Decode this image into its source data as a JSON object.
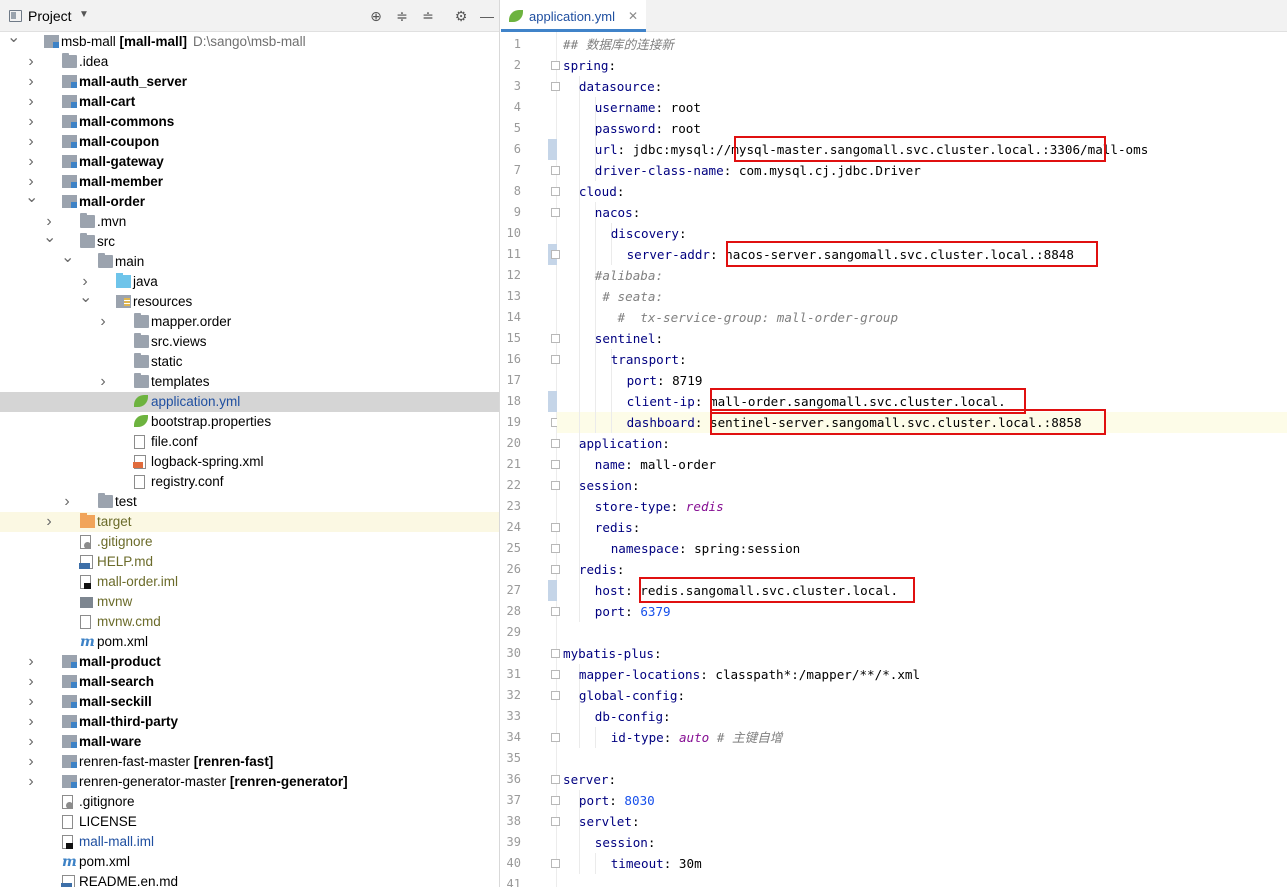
{
  "panel": {
    "title": "Project",
    "tools": [
      "locate-icon",
      "expand-all-icon",
      "collapse-all-icon",
      "settings-icon",
      "hide-icon"
    ]
  },
  "tree": [
    {
      "indent": 0,
      "arrow": "down",
      "icon": "module",
      "label": "msb-mall",
      "suffix": "[mall-mall]",
      "path": "D:\\sango\\msb-mall",
      "style": "normal"
    },
    {
      "indent": 1,
      "arrow": "right",
      "icon": "folder",
      "label": ".idea",
      "style": "normal"
    },
    {
      "indent": 1,
      "arrow": "right",
      "icon": "module",
      "label": "mall-auth_server",
      "style": "bold"
    },
    {
      "indent": 1,
      "arrow": "right",
      "icon": "module",
      "label": "mall-cart",
      "style": "bold"
    },
    {
      "indent": 1,
      "arrow": "right",
      "icon": "module",
      "label": "mall-commons",
      "style": "bold"
    },
    {
      "indent": 1,
      "arrow": "right",
      "icon": "module",
      "label": "mall-coupon",
      "style": "bold"
    },
    {
      "indent": 1,
      "arrow": "right",
      "icon": "module",
      "label": "mall-gateway",
      "style": "bold"
    },
    {
      "indent": 1,
      "arrow": "right",
      "icon": "module",
      "label": "mall-member",
      "style": "bold"
    },
    {
      "indent": 1,
      "arrow": "down",
      "icon": "module",
      "label": "mall-order",
      "style": "bold"
    },
    {
      "indent": 2,
      "arrow": "right",
      "icon": "folder",
      "label": ".mvn",
      "style": "normal"
    },
    {
      "indent": 2,
      "arrow": "down",
      "icon": "folder",
      "label": "src",
      "style": "normal"
    },
    {
      "indent": 3,
      "arrow": "down",
      "icon": "folder",
      "label": "main",
      "style": "normal"
    },
    {
      "indent": 4,
      "arrow": "right",
      "icon": "folder-blue",
      "label": "java",
      "style": "normal"
    },
    {
      "indent": 4,
      "arrow": "down",
      "icon": "folder-res",
      "label": "resources",
      "style": "normal"
    },
    {
      "indent": 5,
      "arrow": "right",
      "icon": "folder",
      "label": "mapper.order",
      "style": "normal"
    },
    {
      "indent": 5,
      "arrow": "",
      "icon": "folder",
      "label": "src.views",
      "style": "normal"
    },
    {
      "indent": 5,
      "arrow": "",
      "icon": "folder",
      "label": "static",
      "style": "normal"
    },
    {
      "indent": 5,
      "arrow": "right",
      "icon": "folder",
      "label": "templates",
      "style": "normal"
    },
    {
      "indent": 5,
      "arrow": "",
      "icon": "leaf",
      "label": "application.yml",
      "style": "blue",
      "selected": true
    },
    {
      "indent": 5,
      "arrow": "",
      "icon": "leaf",
      "label": "bootstrap.properties",
      "style": "normal"
    },
    {
      "indent": 5,
      "arrow": "",
      "icon": "file",
      "label": "file.conf",
      "style": "normal"
    },
    {
      "indent": 5,
      "arrow": "",
      "icon": "xml",
      "label": "logback-spring.xml",
      "style": "normal"
    },
    {
      "indent": 5,
      "arrow": "",
      "icon": "file",
      "label": "registry.conf",
      "style": "normal"
    },
    {
      "indent": 3,
      "arrow": "right",
      "icon": "folder",
      "label": "test",
      "style": "normal"
    },
    {
      "indent": 2,
      "arrow": "right",
      "icon": "folder-orange",
      "label": "target",
      "style": "olive",
      "excluded": true
    },
    {
      "indent": 2,
      "arrow": "",
      "icon": "gitignore",
      "label": ".gitignore",
      "style": "olive"
    },
    {
      "indent": 2,
      "arrow": "",
      "icon": "md",
      "label": "HELP.md",
      "style": "olive"
    },
    {
      "indent": 2,
      "arrow": "",
      "icon": "iml",
      "label": "mall-order.iml",
      "style": "olive"
    },
    {
      "indent": 2,
      "arrow": "",
      "icon": "shell",
      "label": "mvnw",
      "style": "olive"
    },
    {
      "indent": 2,
      "arrow": "",
      "icon": "file",
      "label": "mvnw.cmd",
      "style": "olive"
    },
    {
      "indent": 2,
      "arrow": "",
      "icon": "mvn",
      "label": "pom.xml",
      "style": "normal"
    },
    {
      "indent": 1,
      "arrow": "right",
      "icon": "module",
      "label": "mall-product",
      "style": "bold"
    },
    {
      "indent": 1,
      "arrow": "right",
      "icon": "module",
      "label": "mall-search",
      "style": "bold"
    },
    {
      "indent": 1,
      "arrow": "right",
      "icon": "module",
      "label": "mall-seckill",
      "style": "bold"
    },
    {
      "indent": 1,
      "arrow": "right",
      "icon": "module",
      "label": "mall-third-party",
      "style": "bold"
    },
    {
      "indent": 1,
      "arrow": "right",
      "icon": "module",
      "label": "mall-ware",
      "style": "bold"
    },
    {
      "indent": 1,
      "arrow": "right",
      "icon": "module",
      "label": "renren-fast-master",
      "suffix": "[renren-fast]",
      "style": "normal"
    },
    {
      "indent": 1,
      "arrow": "right",
      "icon": "module",
      "label": "renren-generator-master",
      "suffix": "[renren-generator]",
      "style": "normal"
    },
    {
      "indent": 1,
      "arrow": "",
      "icon": "gitignore",
      "label": ".gitignore",
      "style": "normal"
    },
    {
      "indent": 1,
      "arrow": "",
      "icon": "file",
      "label": "LICENSE",
      "style": "normal"
    },
    {
      "indent": 1,
      "arrow": "",
      "icon": "iml",
      "label": "mall-mall.iml",
      "style": "blue"
    },
    {
      "indent": 1,
      "arrow": "",
      "icon": "mvn",
      "label": "pom.xml",
      "style": "normal"
    },
    {
      "indent": 1,
      "arrow": "",
      "icon": "md",
      "label": "README.en.md",
      "style": "normal"
    }
  ],
  "editor": {
    "tab": {
      "label": "application.yml",
      "close": "✕"
    },
    "current_line": 19,
    "lines": [
      {
        "n": 1,
        "indent": 0,
        "tokens": [
          [
            "c",
            "## 数据库的连接新"
          ]
        ]
      },
      {
        "n": 2,
        "indent": 0,
        "tokens": [
          [
            "k",
            "spring"
          ],
          [
            "v",
            ":"
          ]
        ]
      },
      {
        "n": 3,
        "indent": 1,
        "tokens": [
          [
            "k",
            "datasource"
          ],
          [
            "v",
            ":"
          ]
        ]
      },
      {
        "n": 4,
        "indent": 2,
        "tokens": [
          [
            "k",
            "username"
          ],
          [
            "v",
            ": root"
          ]
        ]
      },
      {
        "n": 5,
        "indent": 2,
        "tokens": [
          [
            "k",
            "password"
          ],
          [
            "v",
            ": root"
          ]
        ]
      },
      {
        "n": 6,
        "indent": 2,
        "tokens": [
          [
            "k",
            "url"
          ],
          [
            "v",
            ": jdbc:mysql://mysql-master.sangomall.svc.cluster.local.:3306/mall-oms"
          ]
        ]
      },
      {
        "n": 7,
        "indent": 2,
        "tokens": [
          [
            "k",
            "driver-class-name"
          ],
          [
            "v",
            ": com.mysql.cj.jdbc.Driver"
          ]
        ]
      },
      {
        "n": 8,
        "indent": 1,
        "tokens": [
          [
            "k",
            "cloud"
          ],
          [
            "v",
            ":"
          ]
        ]
      },
      {
        "n": 9,
        "indent": 2,
        "tokens": [
          [
            "k",
            "nacos"
          ],
          [
            "v",
            ":"
          ]
        ]
      },
      {
        "n": 10,
        "indent": 3,
        "tokens": [
          [
            "k",
            "discovery"
          ],
          [
            "v",
            ":"
          ]
        ]
      },
      {
        "n": 11,
        "indent": 4,
        "tokens": [
          [
            "k",
            "server-addr"
          ],
          [
            "v",
            ": nacos-server.sangomall.svc.cluster.local.:8848"
          ]
        ]
      },
      {
        "n": 12,
        "indent": 2,
        "tokens": [
          [
            "c",
            "#alibaba:"
          ]
        ]
      },
      {
        "n": 13,
        "indent": 2,
        "tokens": [
          [
            "c",
            " # seata:"
          ]
        ]
      },
      {
        "n": 14,
        "indent": 2,
        "tokens": [
          [
            "c",
            "   #  tx-service-group: mall-order-group"
          ]
        ]
      },
      {
        "n": 15,
        "indent": 2,
        "tokens": [
          [
            "k",
            "sentinel"
          ],
          [
            "v",
            ":"
          ]
        ]
      },
      {
        "n": 16,
        "indent": 3,
        "tokens": [
          [
            "k",
            "transport"
          ],
          [
            "v",
            ":"
          ]
        ]
      },
      {
        "n": 17,
        "indent": 4,
        "tokens": [
          [
            "k",
            "port"
          ],
          [
            "v",
            ": 8719"
          ]
        ]
      },
      {
        "n": 18,
        "indent": 4,
        "tokens": [
          [
            "k",
            "client-ip"
          ],
          [
            "v",
            ": mall-order.sangomall.svc.cluster.local."
          ]
        ]
      },
      {
        "n": 19,
        "indent": 4,
        "tokens": [
          [
            "k",
            "dashboard"
          ],
          [
            "v",
            ": sentinel-server.sangomall.svc.cluster.local.:8858"
          ]
        ]
      },
      {
        "n": 20,
        "indent": 1,
        "tokens": [
          [
            "k",
            "application"
          ],
          [
            "v",
            ":"
          ]
        ]
      },
      {
        "n": 21,
        "indent": 2,
        "tokens": [
          [
            "k",
            "name"
          ],
          [
            "v",
            ": mall-order"
          ]
        ]
      },
      {
        "n": 22,
        "indent": 1,
        "tokens": [
          [
            "k",
            "session"
          ],
          [
            "v",
            ":"
          ]
        ]
      },
      {
        "n": 23,
        "indent": 2,
        "tokens": [
          [
            "k",
            "store-type"
          ],
          [
            "v",
            ": "
          ],
          [
            "p",
            "redis"
          ]
        ]
      },
      {
        "n": 24,
        "indent": 2,
        "tokens": [
          [
            "k",
            "redis"
          ],
          [
            "v",
            ":"
          ]
        ]
      },
      {
        "n": 25,
        "indent": 3,
        "tokens": [
          [
            "k",
            "namespace"
          ],
          [
            "v",
            ": spring:session"
          ]
        ]
      },
      {
        "n": 26,
        "indent": 1,
        "tokens": [
          [
            "k",
            "redis"
          ],
          [
            "v",
            ":"
          ]
        ]
      },
      {
        "n": 27,
        "indent": 2,
        "tokens": [
          [
            "k",
            "host"
          ],
          [
            "v",
            ": redis.sangomall.svc.cluster.local."
          ]
        ]
      },
      {
        "n": 28,
        "indent": 2,
        "tokens": [
          [
            "k",
            "port"
          ],
          [
            "v",
            ": "
          ],
          [
            "n",
            "6379"
          ]
        ]
      },
      {
        "n": 29,
        "indent": 0,
        "tokens": []
      },
      {
        "n": 30,
        "indent": 0,
        "tokens": [
          [
            "k",
            "mybatis-plus"
          ],
          [
            "v",
            ":"
          ]
        ]
      },
      {
        "n": 31,
        "indent": 1,
        "tokens": [
          [
            "k",
            "mapper-locations"
          ],
          [
            "v",
            ": classpath*:/mapper/**/*.xml"
          ]
        ]
      },
      {
        "n": 32,
        "indent": 1,
        "tokens": [
          [
            "k",
            "global-config"
          ],
          [
            "v",
            ":"
          ]
        ]
      },
      {
        "n": 33,
        "indent": 2,
        "tokens": [
          [
            "k",
            "db-config"
          ],
          [
            "v",
            ":"
          ]
        ]
      },
      {
        "n": 34,
        "indent": 3,
        "tokens": [
          [
            "k",
            "id-type"
          ],
          [
            "v",
            ": "
          ],
          [
            "p",
            "auto"
          ],
          [
            "c",
            " # 主键自增"
          ]
        ]
      },
      {
        "n": 35,
        "indent": 0,
        "tokens": []
      },
      {
        "n": 36,
        "indent": 0,
        "tokens": [
          [
            "k",
            "server"
          ],
          [
            "v",
            ":"
          ]
        ]
      },
      {
        "n": 37,
        "indent": 1,
        "tokens": [
          [
            "k",
            "port"
          ],
          [
            "v",
            ": "
          ],
          [
            "n",
            "8030"
          ]
        ]
      },
      {
        "n": 38,
        "indent": 1,
        "tokens": [
          [
            "k",
            "servlet"
          ],
          [
            "v",
            ":"
          ]
        ]
      },
      {
        "n": 39,
        "indent": 2,
        "tokens": [
          [
            "k",
            "session"
          ],
          [
            "v",
            ":"
          ]
        ]
      },
      {
        "n": 40,
        "indent": 3,
        "tokens": [
          [
            "k",
            "timeout"
          ],
          [
            "v",
            ": 30m"
          ]
        ]
      },
      {
        "n": 41,
        "indent": 0,
        "tokens": []
      }
    ]
  },
  "highlights": [
    {
      "line": 6,
      "text": "mysql-master.sangomall.svc.cluster.local.:3306"
    },
    {
      "line": 11,
      "text": "nacos-server.sangomall.svc.cluster.local.:8848"
    },
    {
      "line": 18,
      "text": "mall-order.sangomall.svc.cluster.local."
    },
    {
      "line": 19,
      "text": "sentinel-server.sangomall.svc.cluster.local.:8858"
    },
    {
      "line": 27,
      "text": "redis.sangomall.svc.cluster.local."
    }
  ]
}
